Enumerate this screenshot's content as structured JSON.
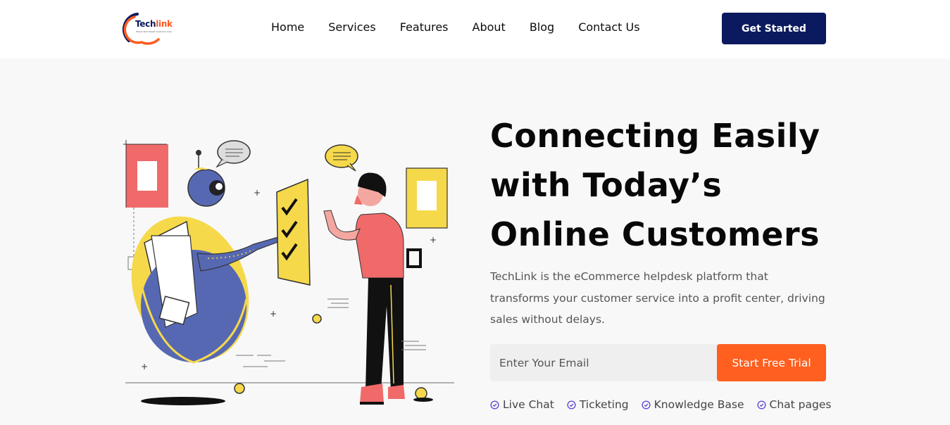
{
  "brand": {
    "name_part1": "Tech",
    "name_part2": "link",
    "tagline": "Where Tech Meets Customer Care"
  },
  "nav": {
    "items": [
      {
        "label": "Home"
      },
      {
        "label": "Services"
      },
      {
        "label": "Features"
      },
      {
        "label": "About"
      },
      {
        "label": "Blog"
      },
      {
        "label": "Contact Us"
      }
    ]
  },
  "header": {
    "cta_label": "Get Started"
  },
  "hero": {
    "title_lines": [
      "Connecting Easily",
      "with Today’s",
      "Online Customers"
    ],
    "description": "TechLink is the eCommerce helpdesk platform that transforms your customer service into a profit center, driving sales without delays.",
    "email_placeholder": "Enter Your Email",
    "trial_label": "Start Free Trial",
    "features": [
      {
        "label": "Live Chat",
        "icon": "check-circle-icon"
      },
      {
        "label": "Ticketing",
        "icon": "check-circle-icon"
      },
      {
        "label": "Knowledge Base",
        "icon": "check-circle-icon"
      },
      {
        "label": "Chat pages",
        "icon": "check-circle-icon"
      }
    ]
  },
  "colors": {
    "navy": "#0b1a5e",
    "orange": "#ff5f1f",
    "check": "#5b3fd6"
  }
}
